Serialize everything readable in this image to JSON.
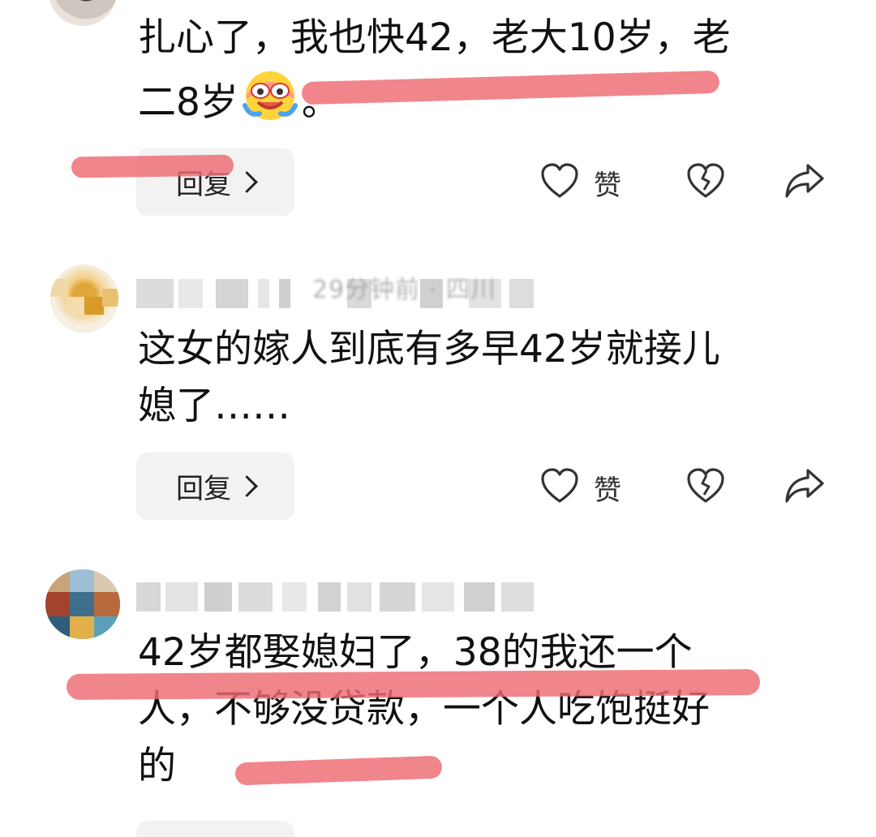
{
  "comments": [
    {
      "text_line1": "扎心了，我也快42，老大10岁，老",
      "text_line2_pre": "二8岁",
      "text_line2_post": "。",
      "emoji": "crying-laugh-emoji",
      "reply_label": "回复",
      "like_label": "赞"
    },
    {
      "meta": "29分钟前 · 四川",
      "text_line1": "这女的嫁人到底有多早42岁就接儿",
      "text_line2": "媳了……",
      "reply_label": "回复",
      "like_label": "赞"
    },
    {
      "text_line1": "42岁都娶媳妇了，38的我还一个",
      "text_line2": "人，不够没贷款，一个人吃饱挺好",
      "text_line3": "的"
    }
  ],
  "icons": {
    "like": "heart-outline-icon",
    "dislike": "broken-heart-icon",
    "share": "share-arrow-icon",
    "reply_chevron": "chevron-right-icon"
  },
  "colors": {
    "marker": "#ee6a73",
    "pill_bg": "#f2f2f2",
    "icon_stroke": "#333333"
  }
}
